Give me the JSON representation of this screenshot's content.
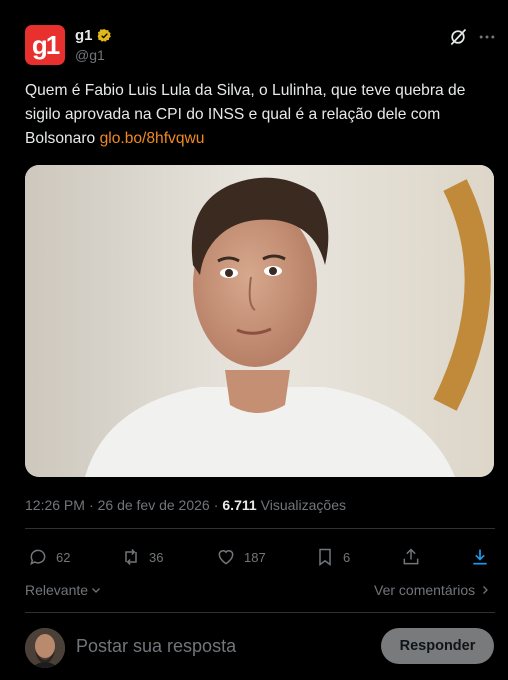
{
  "post": {
    "logo_text": "g1",
    "account_name": "g1",
    "handle": "@g1",
    "text": "Quem é Fabio Luis Lula da Silva, o Lulinha, que teve quebra de sigilo aprovada na CPI do INSS e qual é a relação dele com Bolsonaro ",
    "link": "glo.bo/8hfvqwu",
    "time": "12:26 PM",
    "separator": "·",
    "date": "26 de fev de 2026",
    "separator2": "·",
    "views_count": "6.711",
    "views_label": "Visualizações"
  },
  "actions": {
    "replies": "62",
    "reposts": "36",
    "likes": "187",
    "bookmarks": "6"
  },
  "sort": {
    "label": "Relevante",
    "see_comments": "Ver comentários"
  },
  "reply": {
    "placeholder": "Postar sua resposta",
    "button": "Responder"
  },
  "colors": {
    "background": "#000000",
    "link": "#f08a1f",
    "brand": "#e8312f",
    "verified": "#e2b719",
    "muted": "#71767b"
  },
  "icons": [
    "grok-icon",
    "more-icon",
    "verified-badge-icon",
    "reply-icon",
    "repost-icon",
    "like-icon",
    "bookmark-icon",
    "share-icon",
    "download-icon",
    "chevron-down-icon",
    "chevron-right-icon"
  ]
}
